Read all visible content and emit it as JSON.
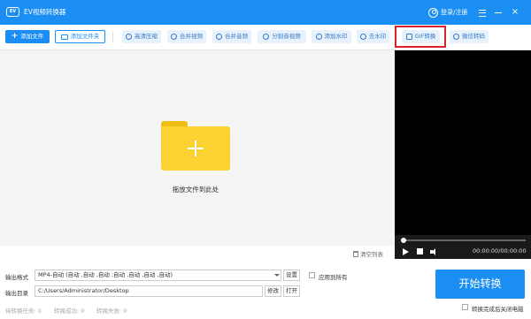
{
  "titlebar": {
    "logo_text": "EV",
    "title": "EV视频转换器",
    "login": "登录/注册",
    "close": "×"
  },
  "toolbar": {
    "add_file": "添加文件",
    "add_folder": "添加文件夹",
    "tools": [
      "高清压缩",
      "合并视频",
      "合并音频",
      "分割音视频",
      "添加水印",
      "去水印",
      "GIF转换",
      "微信转码"
    ],
    "highlight_color": "#d8232a"
  },
  "droparea": {
    "hint": "拖放文件到此处",
    "clear_list": "清空列表"
  },
  "player": {
    "time": "00:00:00/00:00:00",
    "progress": 0.0
  },
  "output": {
    "format_label": "输出格式",
    "format_value": "MP4-自动 (自动 ,自动 ,自动 ;自动 ,自动 ,自动 ,自动)",
    "settings": "设置",
    "apply_all": "应用到所有",
    "dir_label": "输出目录",
    "dir_value": "C:/Users/Administrator/Desktop",
    "modify": "修改",
    "open": "打开"
  },
  "convert": {
    "button": "开始转换",
    "shutdown": "转换完成后关闭电脑"
  },
  "status": {
    "pending": "待转换任务: 0",
    "success": "转换成功: 0",
    "failed": "转换失败: 0"
  },
  "colors": {
    "accent": "#1a8ef3",
    "folder": "#fcd233"
  }
}
